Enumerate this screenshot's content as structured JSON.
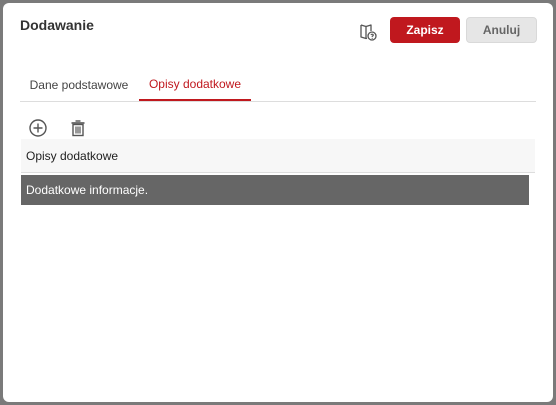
{
  "dialog": {
    "title": "Dodawanie",
    "save_label": "Zapisz",
    "cancel_label": "Anuluj"
  },
  "tabs": [
    {
      "label": "Dane podstawowe",
      "active": false
    },
    {
      "label": "Opisy dodatkowe",
      "active": true
    }
  ],
  "toolbar": {
    "add_icon": "add-circle-icon",
    "delete_icon": "trash-icon"
  },
  "grid": {
    "column_header": "Opisy dodatkowe",
    "rows": [
      "Dodatkowe informacje."
    ]
  },
  "colors": {
    "accent": "#c0181e",
    "selected_row": "#666666",
    "cancel_bg": "#e6e6e6"
  }
}
